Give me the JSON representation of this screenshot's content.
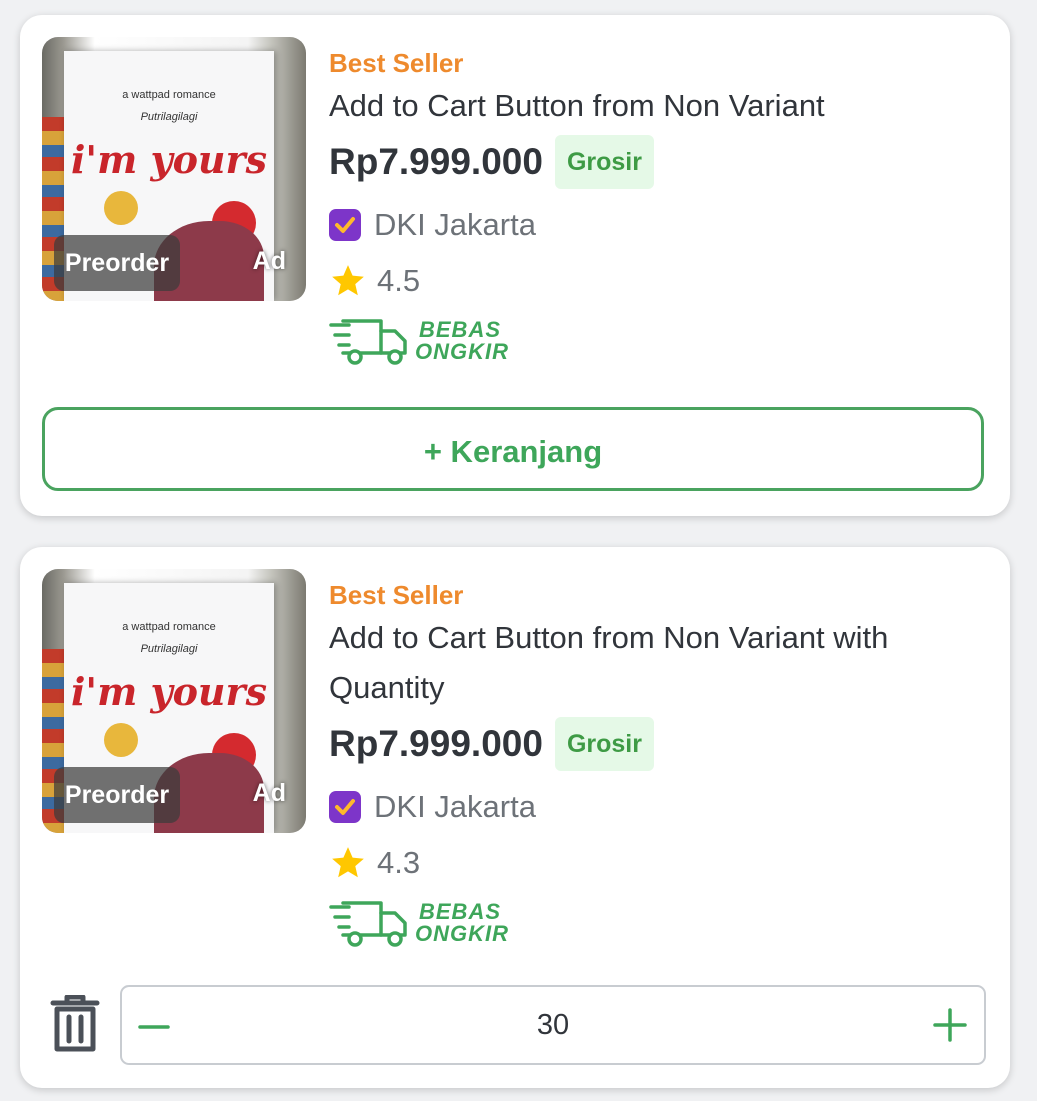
{
  "products": [
    {
      "image_tag": "Preorder",
      "ad_label": "Ad",
      "cover_text": {
        "line1": "a wattpad romance",
        "line2": "Putrilagilagi",
        "title": "i'm yours"
      },
      "label": "Best Seller",
      "name": "Add to Cart Button from Non Variant",
      "price": "Rp7.999.000",
      "badge": "Grosir",
      "location": "DKI Jakarta",
      "rating": "4.5",
      "shipping": {
        "line1": "BEBAS",
        "line2": "ONGKIR"
      },
      "cart_button": "+ Keranjang"
    },
    {
      "image_tag": "Preorder",
      "ad_label": "Ad",
      "cover_text": {
        "line1": "a wattpad romance",
        "line2": "Putrilagilagi",
        "title": "i'm yours"
      },
      "label": "Best Seller",
      "name": "Add to Cart Button from Non Variant with Quantity",
      "price": "Rp7.999.000",
      "badge": "Grosir",
      "location": "DKI Jakarta",
      "rating": "4.3",
      "shipping": {
        "line1": "BEBAS",
        "line2": "ONGKIR"
      },
      "quantity": "30"
    }
  ],
  "colors": {
    "accent_green": "#3ea65a",
    "best_seller_orange": "#ee8a2d",
    "grosir_bg": "#e5f9e7",
    "shop_badge_purple": "#7d35c9",
    "star_yellow": "#ffc700"
  },
  "icons": [
    "shop-badge-icon",
    "star-icon",
    "delivery-truck-icon",
    "trash-icon",
    "minus-icon",
    "plus-icon"
  ]
}
